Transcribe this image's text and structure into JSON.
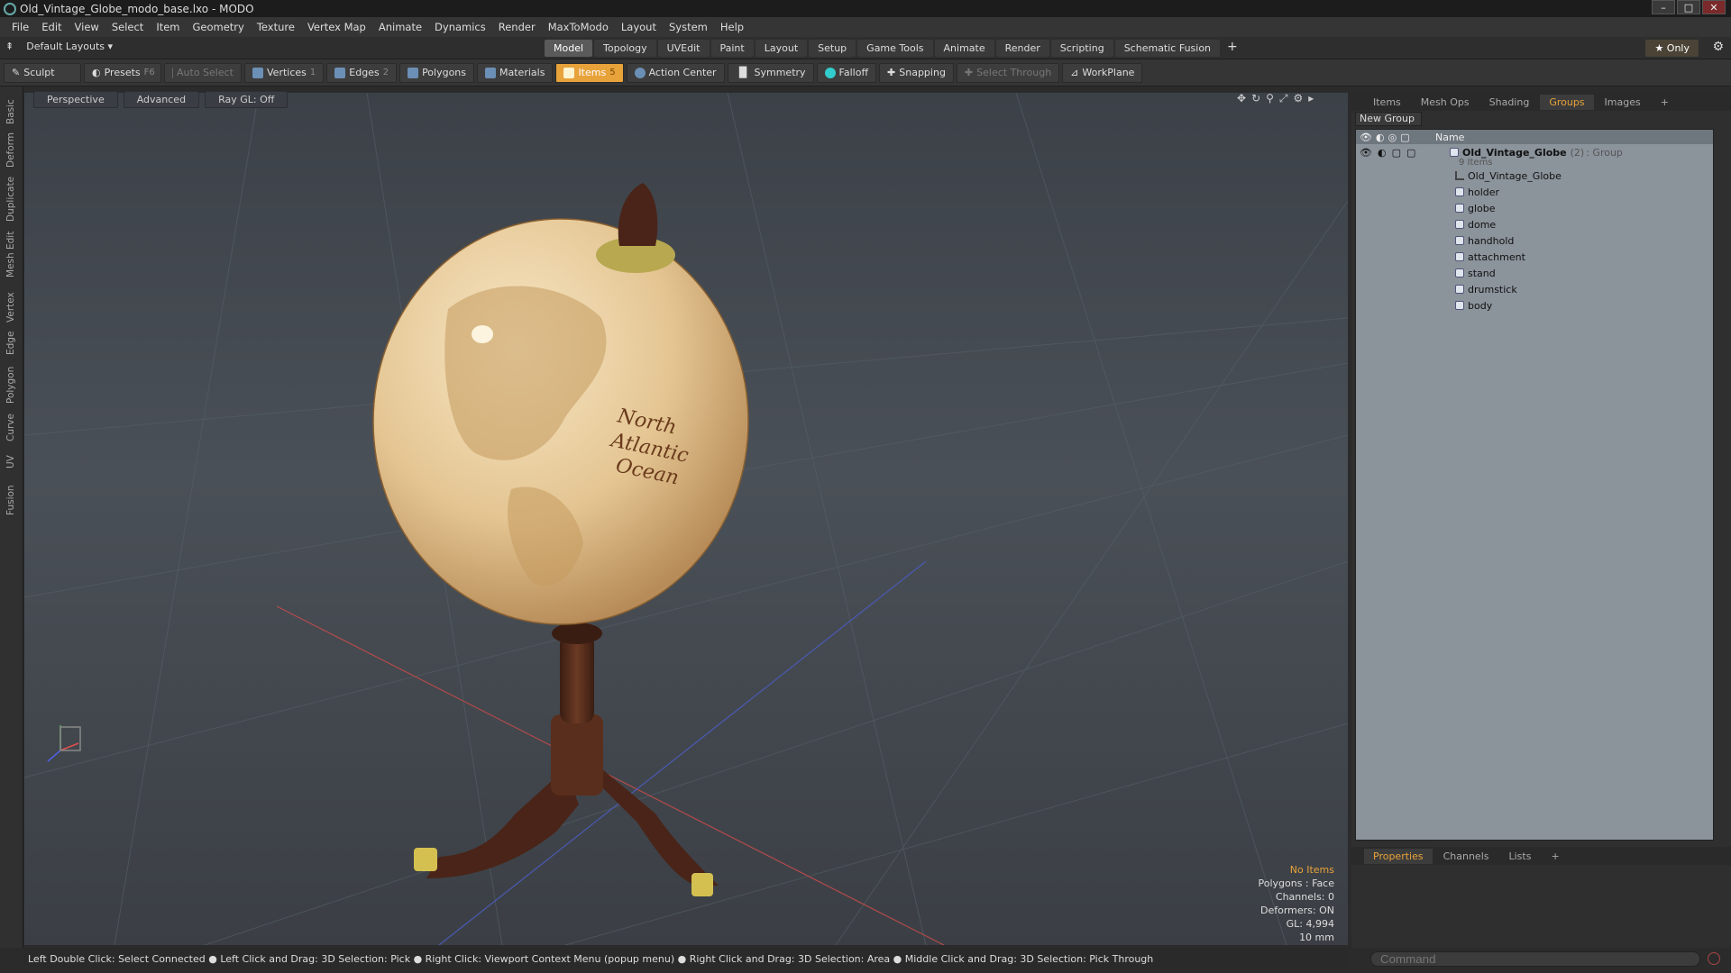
{
  "window": {
    "title": "Old_Vintage_Globe_modo_base.lxo - MODO",
    "controls": [
      "–",
      "□",
      "✕"
    ]
  },
  "menu": [
    "File",
    "Edit",
    "View",
    "Select",
    "Item",
    "Geometry",
    "Texture",
    "Vertex Map",
    "Animate",
    "Dynamics",
    "Render",
    "MaxToModo",
    "Layout",
    "System",
    "Help"
  ],
  "modebar": {
    "layouts": "Default Layouts ▾",
    "tabs": [
      "Model",
      "Topology",
      "UVEdit",
      "Paint",
      "Layout",
      "Setup",
      "Game Tools",
      "Animate",
      "Render",
      "Scripting",
      "Schematic Fusion"
    ],
    "add": "+",
    "only": "★ Only"
  },
  "toolbar": {
    "sculpt": "Sculpt",
    "presets": "Presets",
    "presets_key": "F6",
    "auto_select": "Auto Select",
    "vertices": "Vertices",
    "vertices_count": "1",
    "edges": "Edges",
    "edges_count": "2",
    "polygons": "Polygons",
    "materials": "Materials",
    "items": "Items",
    "items_count": "5",
    "action_center": "Action Center",
    "symmetry": "Symmetry",
    "falloff": "Falloff",
    "snapping": "Snapping",
    "select_through": "Select Through",
    "workplane": "WorkPlane"
  },
  "left_tabs": [
    "Basic",
    "Deform",
    "Duplicate",
    "Mesh Edit",
    "Vertex",
    "Edge",
    "Polygon",
    "Curve",
    "UV",
    "Fusion"
  ],
  "viewport": {
    "view": "Perspective",
    "mode": "Advanced",
    "raygl": "Ray GL: Off",
    "globe_text": [
      "North",
      "Atlantic",
      "Ocean"
    ],
    "hud": {
      "no_items": "No Items",
      "polygons": "Polygons : Face",
      "channels": "Channels: 0",
      "deformers": "Deformers: ON",
      "gl": "GL: 4,994",
      "unit": "10 mm"
    }
  },
  "status": "Left Double Click: Select Connected ● Left Click and Drag: 3D Selection: Pick ● Right Click: Viewport Context Menu (popup menu) ● Right Click and Drag: 3D Selection: Area ● Middle Click and Drag: 3D Selection: Pick Through",
  "right_panel": {
    "tabs": [
      "Items",
      "Mesh Ops",
      "Shading",
      "Groups",
      "Images"
    ],
    "active_tab": "Groups",
    "new_group": "New Group",
    "col_name": "Name",
    "group": {
      "name": "Old_Vintage_Globe",
      "count": "(2)",
      "type": ": Group",
      "items_label": "9 Items"
    },
    "children": [
      "Old_Vintage_Globe",
      "holder",
      "globe",
      "dome",
      "handhold",
      "attachment",
      "stand",
      "drumstick",
      "body"
    ]
  },
  "props": {
    "tabs": [
      "Properties",
      "Channels",
      "Lists"
    ],
    "active": "Properties"
  },
  "command": {
    "placeholder": "Command"
  },
  "colors": {
    "accent": "#e8a23a",
    "tree_bg": "#8b939b"
  }
}
